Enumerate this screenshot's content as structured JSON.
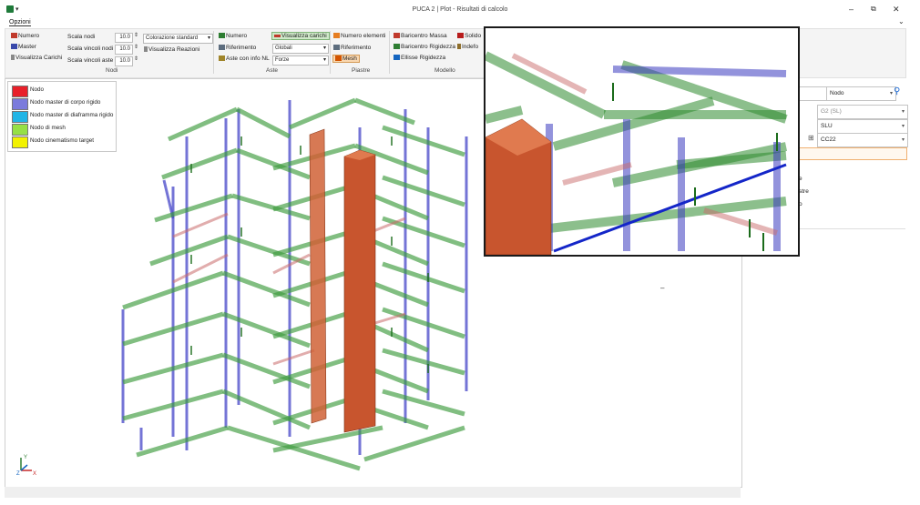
{
  "window": {
    "title": "PUCA 2 | Plot - Risultati di calcolo",
    "qa_label": "▾",
    "controls": {
      "minimize": "–",
      "restore": "⧉",
      "close": "✕"
    }
  },
  "menu": {
    "tab": "Opzioni",
    "collapse": "⌄"
  },
  "ribbon": {
    "nodi": {
      "label": "Nodi",
      "numero": "Numero",
      "master": "Master",
      "visualizza_carichi": "Visualizza Carichi",
      "scala_nodi": "Scala nodi",
      "scala_vincoli_nodi": "Scala vincoli nodi",
      "scala_vincoli_aste": "Scala vincoli aste",
      "scala_nodi_value": "10.0",
      "scala_vincoli_nodi_value": "10.0",
      "scala_vincoli_aste_value": "10.0",
      "colorazione": "Colorazione standard",
      "visualizza_reazioni": "Visualizza Reazioni"
    },
    "aste": {
      "label": "Aste",
      "numero": "Numero",
      "riferimento": "Riferimento",
      "info_nl": "Aste con info NL",
      "visualizza_carichi": "Visualizza carichi",
      "globali": "Globali",
      "forze": "Forze"
    },
    "piastre": {
      "label": "Piastre",
      "numero_elementi": "Numero elementi",
      "riferimento": "Riferimento",
      "mesh": "Mesh"
    },
    "modello": {
      "label": "Modello",
      "baricentro_massa": "Baricentro Massa",
      "baricentro_rigidezza": "Baricentro Rigidezza",
      "ellisse_rigidezza": "Ellisse Rigidezza",
      "solido": "Solido",
      "indeformata": "Indefo"
    }
  },
  "legend": {
    "items": [
      {
        "label": "Nodo",
        "color": "#e8202a"
      },
      {
        "label": "Nodo master di corpo rigido",
        "color": "#7b7bdc"
      },
      {
        "label": "Nodo master di diaframma rigido",
        "color": "#22b5e6"
      },
      {
        "label": "Nodo di mesh",
        "color": "#96e046"
      },
      {
        "label": "Nodo cinematismo target",
        "color": "#f2f200"
      }
    ]
  },
  "right_panel": {
    "type_select": "Nodo",
    "combo1": "G2 (SL)",
    "combo2": "SLU",
    "combo3": "CC22",
    "partial_rows": [
      "e",
      "stre",
      "o",
      "i"
    ]
  },
  "axes": {
    "y": "Y",
    "x": "X",
    "z": "Z"
  },
  "colors": {
    "beam_green": "#2f8a2f",
    "beam_blue": "#3b3bbf",
    "wall_brick": "#c8552e",
    "load_arrow": "#1a6b1a",
    "selected_beam": "#1426c8"
  }
}
